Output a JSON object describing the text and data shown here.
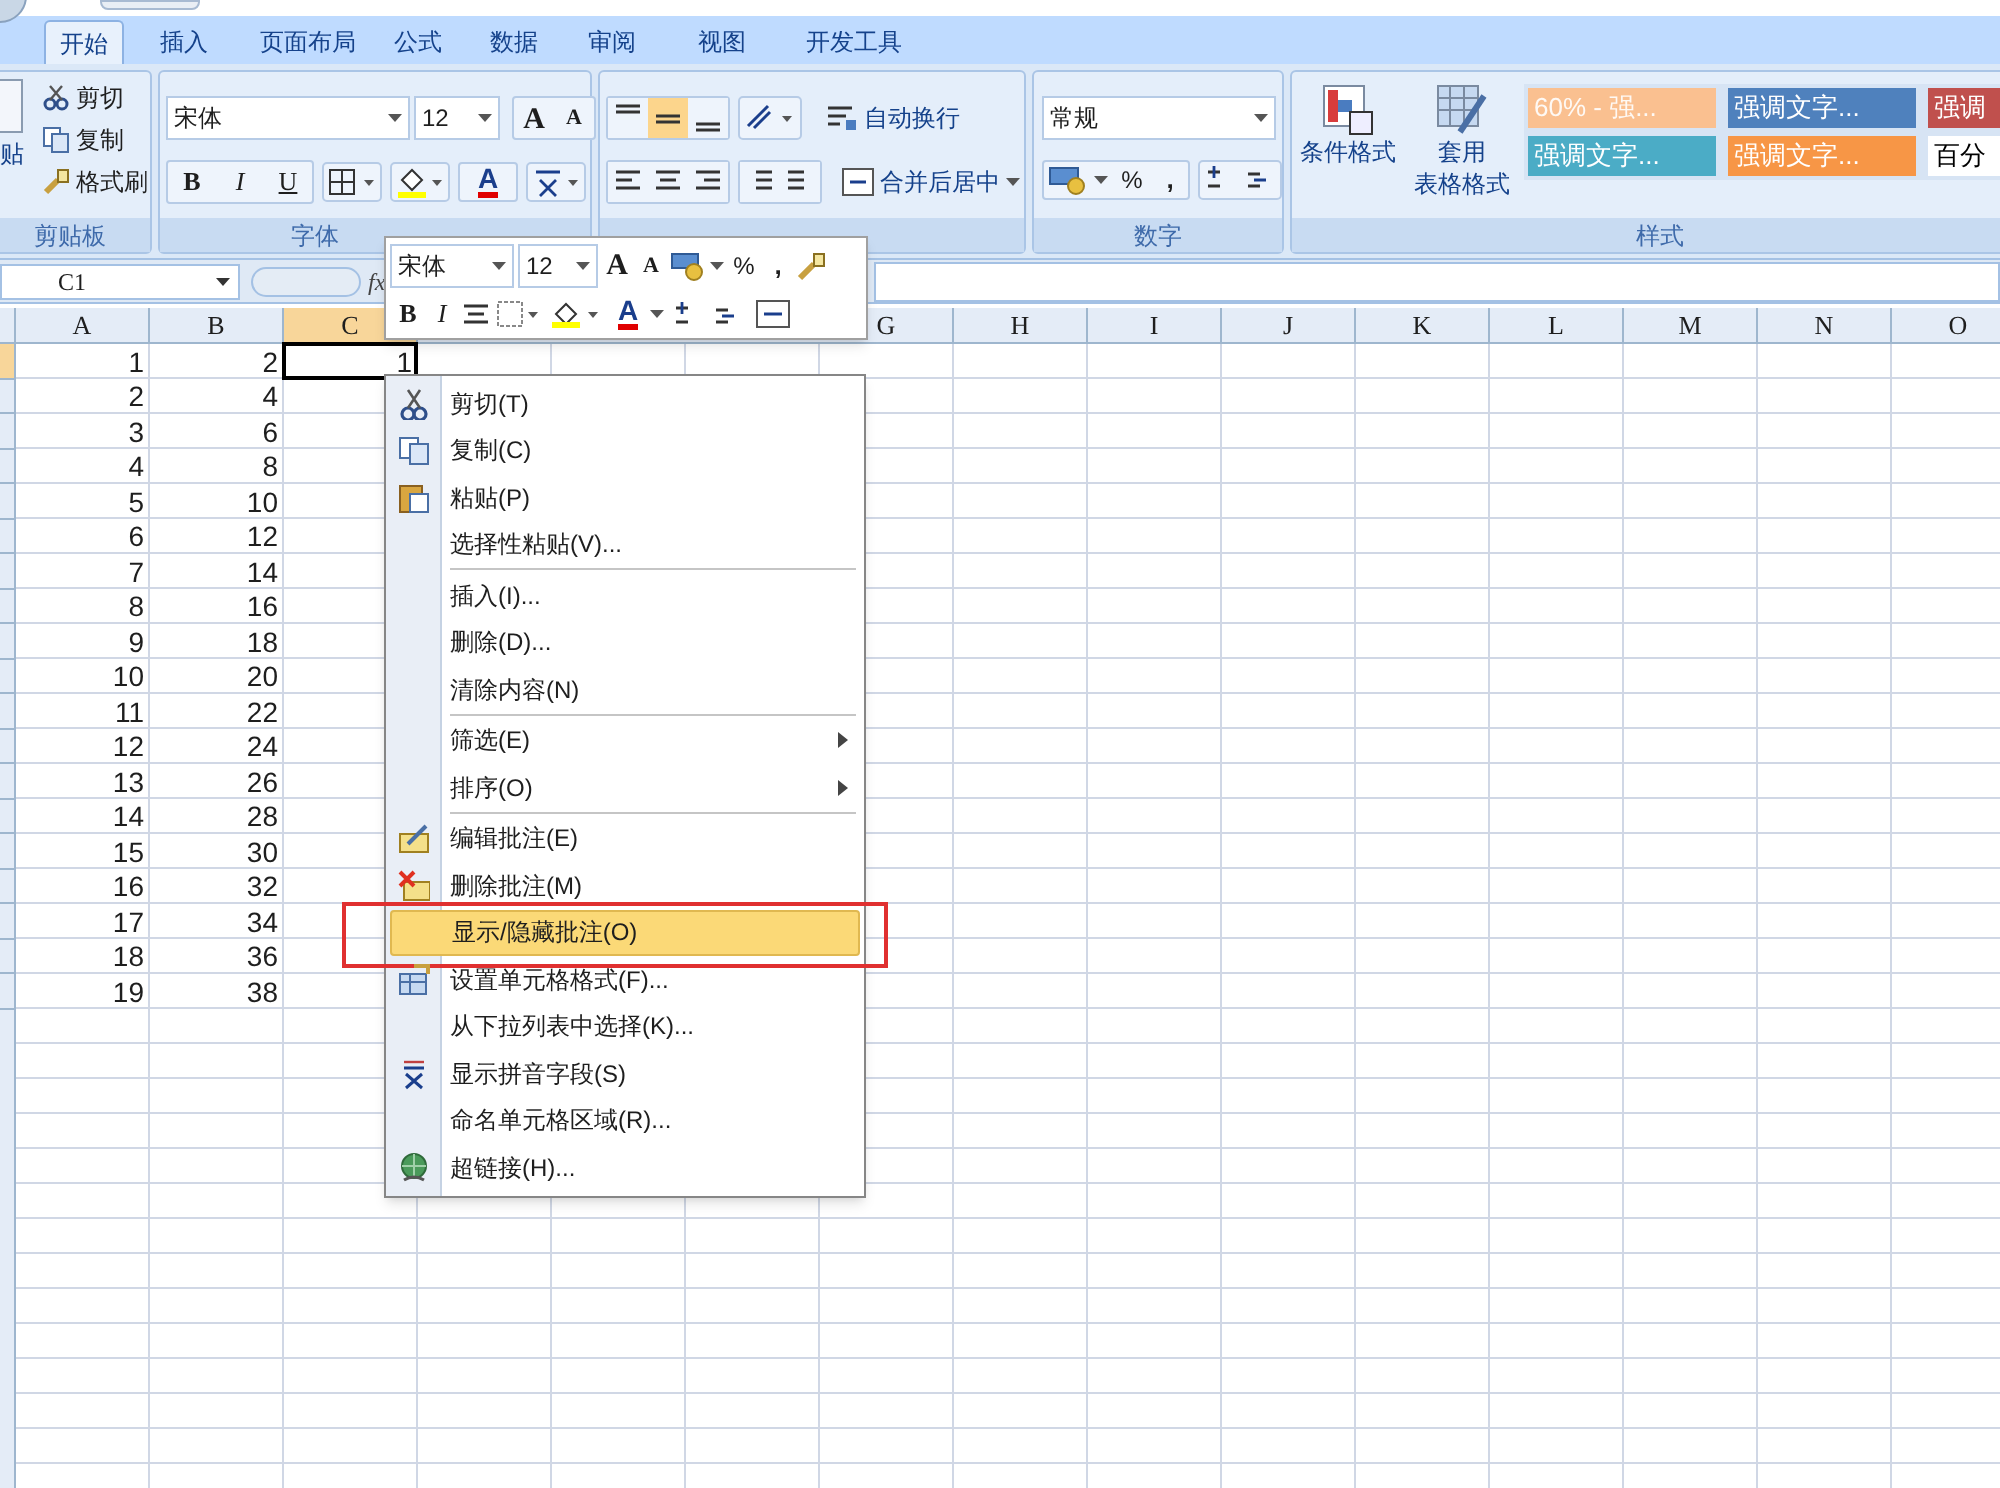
{
  "tabs": [
    {
      "label": "开始",
      "selected": true
    },
    {
      "label": "插入",
      "selected": false
    },
    {
      "label": "页面布局",
      "selected": false
    },
    {
      "label": "公式",
      "selected": false
    },
    {
      "label": "数据",
      "selected": false
    },
    {
      "label": "审阅",
      "selected": false
    },
    {
      "label": "视图",
      "selected": false
    },
    {
      "label": "开发工具",
      "selected": false
    }
  ],
  "clipboard": {
    "paste_label": "贴",
    "items": [
      "剪切",
      "复制",
      "格式刷"
    ],
    "group_label": "剪贴板"
  },
  "font": {
    "font_name": "宋体",
    "font_size": "12",
    "size_buttons": [
      "A",
      "A"
    ],
    "style_buttons": [
      "B",
      "I",
      "U"
    ],
    "font_color": "A",
    "group_label": "字体"
  },
  "alignment": {
    "wrap_label": "自动换行",
    "merge_label": "合并后居中"
  },
  "number": {
    "format": "常规",
    "symbols": [
      "%",
      ","
    ],
    "group_label": "数字"
  },
  "styles": {
    "conditional_label": "条件格式",
    "table_label": [
      "套用",
      "表格格式"
    ],
    "cells": [
      {
        "label": "60% - 强...",
        "color": "#fac090"
      },
      {
        "label": "强调文字...",
        "color": "#4f81bd"
      },
      {
        "label": "强调",
        "color": "#c0504d"
      },
      {
        "label": "强调文字...",
        "color": "#4bacc6"
      },
      {
        "label": "强调文字...",
        "color": "#f79646"
      },
      {
        "label": "百分",
        "color": "#ffffff"
      }
    ],
    "group_label": "样式"
  },
  "formula_bar": {
    "name_box": "C1",
    "fx_label": "fx"
  },
  "columns": [
    {
      "label": "A",
      "selected": false
    },
    {
      "label": "B",
      "selected": false
    },
    {
      "label": "C",
      "selected": true
    }
  ],
  "columns_right": [
    {
      "label": "G",
      "selected": false
    },
    {
      "label": "H",
      "selected": false
    },
    {
      "label": "I",
      "selected": false
    },
    {
      "label": "J",
      "selected": false
    },
    {
      "label": "K",
      "selected": false
    },
    {
      "label": "L",
      "selected": false
    },
    {
      "label": "M",
      "selected": false
    },
    {
      "label": "N",
      "selected": false
    },
    {
      "label": "O",
      "selected": false
    }
  ],
  "rows": [
    {
      "selected": true,
      "cells": [
        "1",
        "2",
        "1"
      ]
    },
    {
      "selected": false,
      "cells": [
        "2",
        "4"
      ]
    },
    {
      "selected": false,
      "cells": [
        "3",
        "6"
      ]
    },
    {
      "selected": false,
      "cells": [
        "4",
        "8"
      ]
    },
    {
      "selected": false,
      "cells": [
        "5",
        "10"
      ]
    },
    {
      "selected": false,
      "cells": [
        "6",
        "12"
      ]
    },
    {
      "selected": false,
      "cells": [
        "7",
        "14"
      ]
    },
    {
      "selected": false,
      "cells": [
        "8",
        "16"
      ]
    },
    {
      "selected": false,
      "cells": [
        "9",
        "18"
      ]
    },
    {
      "selected": false,
      "cells": [
        "10",
        "20"
      ]
    },
    {
      "selected": false,
      "cells": [
        "11",
        "22"
      ]
    },
    {
      "selected": false,
      "cells": [
        "12",
        "24"
      ]
    },
    {
      "selected": false,
      "cells": [
        "13",
        "26"
      ]
    },
    {
      "selected": false,
      "cells": [
        "14",
        "28"
      ]
    },
    {
      "selected": false,
      "cells": [
        "15",
        "30"
      ]
    },
    {
      "selected": false,
      "cells": [
        "16",
        "32"
      ]
    },
    {
      "selected": false,
      "cells": [
        "17",
        "34"
      ]
    },
    {
      "selected": false,
      "cells": [
        "18",
        "36"
      ]
    },
    {
      "selected": false,
      "cells": [
        "19",
        "38"
      ]
    }
  ],
  "mini_toolbar": {
    "font_name": "宋体",
    "font_size": "12",
    "size_buttons": [
      "A",
      "A"
    ],
    "symbols": [
      "%",
      ","
    ],
    "style_buttons": [
      "B",
      "I"
    ],
    "font_color": "A"
  },
  "context_menu": {
    "groups": [
      [
        {
          "label": "剪切(T)",
          "submenu": false,
          "selected": false
        },
        {
          "label": "复制(C)",
          "submenu": false,
          "selected": false
        },
        {
          "label": "粘贴(P)",
          "submenu": false,
          "selected": false
        },
        {
          "label": "选择性粘贴(V)...",
          "submenu": false,
          "selected": false
        }
      ],
      [
        {
          "label": "插入(I)...",
          "submenu": false,
          "selected": false
        },
        {
          "label": "删除(D)...",
          "submenu": false,
          "selected": false
        },
        {
          "label": "清除内容(N)",
          "submenu": false,
          "selected": false
        }
      ],
      [
        {
          "label": "筛选(E)",
          "submenu": true,
          "selected": false
        },
        {
          "label": "排序(O)",
          "submenu": true,
          "selected": false
        }
      ],
      [
        {
          "label": "编辑批注(E)",
          "submenu": false,
          "selected": false
        },
        {
          "label": "删除批注(M)",
          "submenu": false,
          "selected": false
        },
        {
          "label": "显示/隐藏批注(O)",
          "submenu": false,
          "selected": true
        },
        {
          "label": "设置单元格格式(F)...",
          "submenu": false,
          "selected": false
        },
        {
          "label": "从下拉列表中选择(K)...",
          "submenu": false,
          "selected": false
        },
        {
          "label": "显示拼音字段(S)",
          "submenu": false,
          "selected": false
        },
        {
          "label": "命名单元格区域(R)...",
          "submenu": false,
          "selected": false
        },
        {
          "label": "超链接(H)...",
          "submenu": false,
          "selected": false
        }
      ]
    ]
  }
}
